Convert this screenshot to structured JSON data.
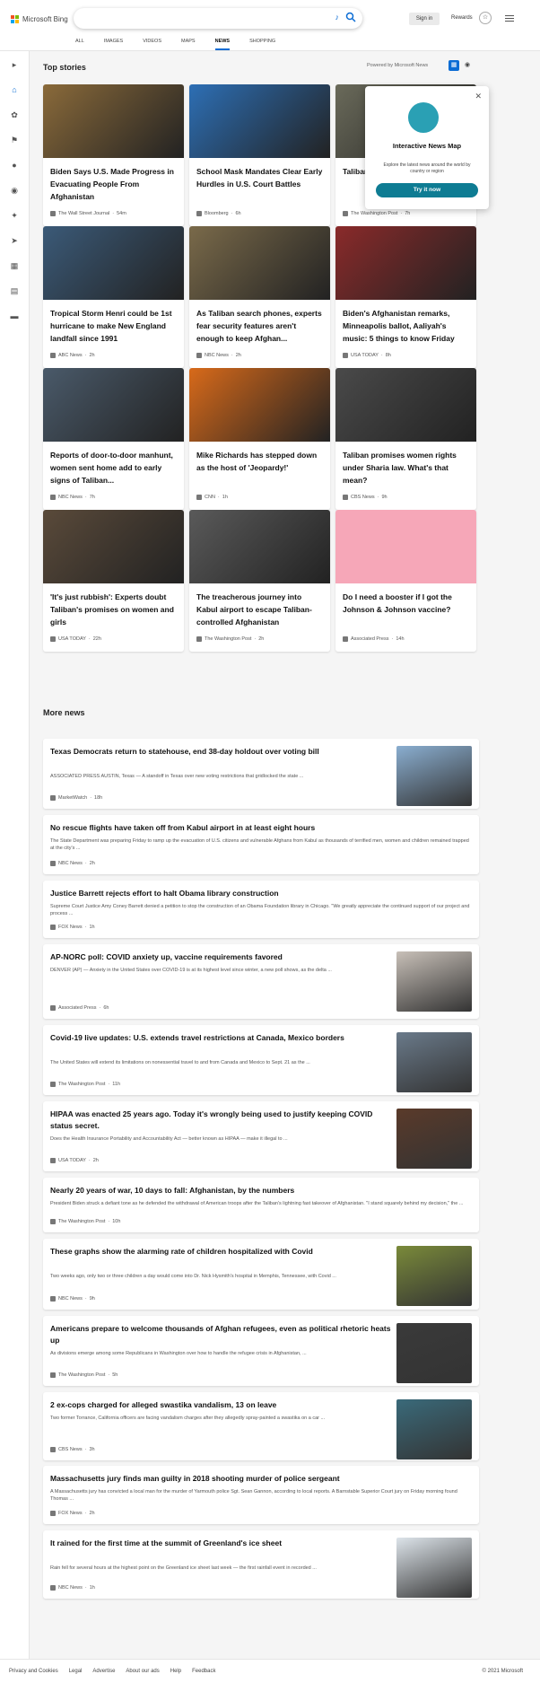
{
  "header": {
    "logo_text": "Microsoft Bing",
    "signin": "Sign in",
    "rewards": "Rewards",
    "nav": [
      "ALL",
      "IMAGES",
      "VIDEOS",
      "MAPS",
      "NEWS",
      "SHOPPING"
    ],
    "nav_active": "NEWS"
  },
  "top_stories": {
    "title": "Top stories",
    "powered": "Powered by Microsoft News",
    "popup": {
      "title": "Interactive News Map",
      "desc": "Explore the latest news around the world by country or region",
      "button": "Try it now"
    },
    "cards": [
      {
        "title": "Biden Says U.S. Made Progress in Evacuating People From Afghanistan",
        "source": "The Wall Street Journal",
        "time": "54m",
        "color": "#8a6a3a"
      },
      {
        "title": "School Mask Mandates Clear Early Hurdles in U.S. Court Battles",
        "source": "Bloomberg",
        "time": "6h",
        "color": "#2d6fb5"
      },
      {
        "title": "Taliban 'collaborators' threat...",
        "source": "The Washington Post",
        "time": "7h",
        "color": "#6a6a5a"
      },
      {
        "title": "Tropical Storm Henri could be 1st hurricane to make New England landfall since 1991",
        "source": "ABC News",
        "time": "2h",
        "color": "#3b5a78"
      },
      {
        "title": "As Taliban search phones, experts fear security features aren't enough to keep Afghan...",
        "source": "NBC News",
        "time": "2h",
        "color": "#7a6a4a"
      },
      {
        "title": "Biden's Afghanistan remarks, Minneapolis ballot, Aaliyah's music: 5 things to know Friday",
        "source": "USA TODAY",
        "time": "8h",
        "color": "#8a2a2a"
      },
      {
        "title": "Reports of door-to-door manhunt, women sent home add to early signs of Taliban...",
        "source": "NBC News",
        "time": "7h",
        "color": "#4a5a6a"
      },
      {
        "title": "Mike Richards has stepped down as the host of 'Jeopardy!'",
        "source": "CNN",
        "time": "1h",
        "color": "#d86a1a"
      },
      {
        "title": "Taliban promises women rights under Sharia law. What's that mean?",
        "source": "CBS News",
        "time": "9h",
        "color": "#4a4a4a"
      },
      {
        "title": "'It's just rubbish': Experts doubt Taliban's promises on women and girls",
        "source": "USA TODAY",
        "time": "22h",
        "color": "#5a4a3a"
      },
      {
        "title": "The treacherous journey into Kabul airport to escape Taliban-controlled Afghanistan",
        "source": "The Washington Post",
        "time": "2h",
        "color": "#5a5a5a"
      },
      {
        "title": "Do I need a booster if I got the Johnson & Johnson vaccine?",
        "source": "Associated Press",
        "time": "14h",
        "color": "#f6a7b8"
      }
    ]
  },
  "more_news": {
    "title": "More news",
    "items": [
      {
        "title": "Texas Democrats return to statehouse, end 38-day holdout over voting bill",
        "desc": "ASSOCIATED PRESS AUSTIN, Texas — A standoff in Texas over new voting restrictions that gridlocked the state ...",
        "source": "MarketWatch",
        "time": "18h",
        "thumb": "#8aaed0"
      },
      {
        "title": "No rescue flights have taken off from Kabul airport in at least eight hours",
        "desc": "The State Department was preparing Friday to ramp up the evacuation of U.S. citizens and vulnerable Afghans from Kabul as thousands of terrified men, women and children remained trapped at the city's ...",
        "source": "NBC News",
        "time": "2h",
        "thumb": ""
      },
      {
        "title": "Justice Barrett rejects effort to halt Obama library construction",
        "desc": "Supreme Court Justice Amy Coney Barrett denied a petition to stop the construction of an Obama Foundation library in Chicago. \"We greatly appreciate the continued support of our project and process ...",
        "source": "FOX News",
        "time": "1h",
        "thumb": ""
      },
      {
        "title": "AP-NORC poll: COVID anxiety up, vaccine requirements favored",
        "desc": "DENVER (AP) — Anxiety in the United States over COVID-19 is at its highest level since winter, a new poll shows, as the delta ...",
        "source": "Associated Press",
        "time": "6h",
        "thumb": "#c8c0b8"
      },
      {
        "title": "Covid-19 live updates: U.S. extends travel restrictions at Canada, Mexico borders",
        "desc": "The United States will extend its limitations on nonessential travel to and from Canada and Mexico to Sept. 21 as the ...",
        "source": "The Washington Post",
        "time": "11h",
        "thumb": "#6a7a8a"
      },
      {
        "title": "HIPAA was enacted 25 years ago. Today it's wrongly being used to justify keeping COVID status secret.",
        "desc": "Does the Health Insurance Portability and Accountability Act — better known as HIPAA — make it illegal to ...",
        "source": "USA TODAY",
        "time": "2h",
        "thumb": "#5a3a2a"
      },
      {
        "title": "Nearly 20 years of war, 10 days to fall: Afghanistan, by the numbers",
        "desc": "President Biden struck a defiant tone as he defended the withdrawal of American troops after the Taliban's lightning fast takeover of Afghanistan. \"I stand squarely behind my decision,\" the ...",
        "source": "The Washington Post",
        "time": "10h",
        "thumb": ""
      },
      {
        "title": "These graphs show the alarming rate of children hospitalized with Covid",
        "desc": "Two weeks ago, only two or three children a day would come into Dr. Nick Hysmith's hospital in Memphis, Tennessee, with Covid ...",
        "source": "NBC News",
        "time": "9h",
        "thumb": "#7a8a3a"
      },
      {
        "title": "Americans prepare to welcome thousands of Afghan refugees, even as political rhetoric heats up",
        "desc": "As divisions emerge among some Republicans in Washington over how to handle the refugee crisis in Afghanistan, ...",
        "source": "The Washington Post",
        "time": "5h",
        "thumb": "#3a3a3a"
      },
      {
        "title": "2 ex-cops charged for alleged swastika vandalism, 13 on leave",
        "desc": "Two former Torrance, California officers are facing vandalism charges after they allegedly spray-painted a swastika on a car ...",
        "source": "CBS News",
        "time": "3h",
        "thumb": "#3a6a7a"
      },
      {
        "title": "Massachusetts jury finds man guilty in 2018 shooting murder of police sergeant",
        "desc": "A Massachusetts jury has convicted a local man for the murder of Yarmouth police Sgt. Sean Gannon, according to local reports. A Barnstable Superior Court jury on Friday morning found Thomas ...",
        "source": "FOX News",
        "time": "2h",
        "thumb": ""
      },
      {
        "title": "It rained for the first time at the summit of Greenland's ice sheet",
        "desc": "Rain fell for several hours at the highest point on the Greenland ice sheet last week — the first rainfall event in recorded ...",
        "source": "NBC News",
        "time": "1h",
        "thumb": "#dde4ea"
      }
    ]
  },
  "footer": {
    "links": [
      "Privacy and Cookies",
      "Legal",
      "Advertise",
      "About our ads",
      "Help",
      "Feedback"
    ],
    "copyright": "© 2021 Microsoft"
  }
}
